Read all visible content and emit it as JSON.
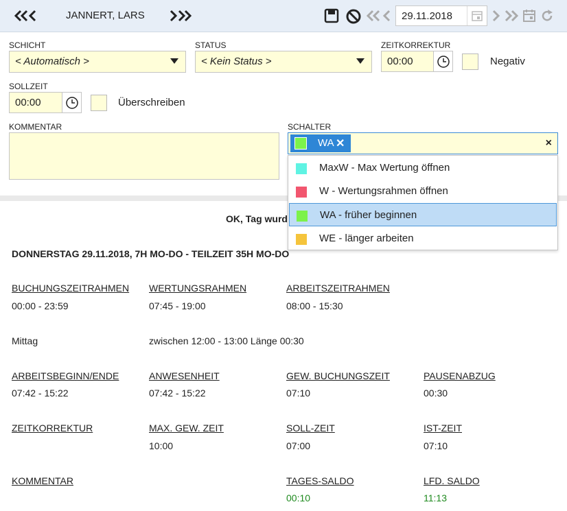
{
  "header": {
    "employee_name": "JANNERT, LARS",
    "date": "29.11.2018",
    "icons": {
      "prev_employee": "double-chevron-left",
      "next_employee": "double-chevron-right",
      "save": "save-icon",
      "cancel": "cancel-icon",
      "first_day": "double-chevron-left",
      "prev_day": "chevron-left",
      "calendar": "calendar-icon",
      "next_day": "chevron-right",
      "last_day": "double-chevron-right",
      "today": "calendar-today-icon",
      "refresh": "refresh-icon"
    }
  },
  "form": {
    "schicht_label": "SCHICHT",
    "schicht_value": "< Automatisch >",
    "status_label": "STATUS",
    "status_value": "< Kein Status >",
    "zeitkorrektur_label": "ZEITKORREKTUR",
    "zeitkorrektur_value": "00:00",
    "negativ_label": "Negativ",
    "sollzeit_label": "SOLLZEIT",
    "sollzeit_value": "00:00",
    "ueberschreiben_label": "Überschreiben",
    "kommentar_label": "KOMMENTAR",
    "kommentar_value": "",
    "schalter_label": "SCHALTER",
    "schalter_selected": {
      "code": "WA",
      "color": "#7cf24b"
    }
  },
  "dropdown": {
    "options": [
      {
        "label": "MaxW - Max Wertung öffnen",
        "color": "#5ff3e3"
      },
      {
        "label": "W - Wertungsrahmen öffnen",
        "color": "#f2566f"
      },
      {
        "label": "WA - früher beginnen",
        "color": "#7cf24b",
        "selected": true
      },
      {
        "label": "WE - länger arbeiten",
        "color": "#f5c43c"
      }
    ]
  },
  "message": "OK, Tag wurde",
  "day": {
    "header": "DONNERSTAG 29.11.2018, 7H MO-DO - TEILZEIT 35H MO-DO",
    "buchungszeitrahmen_label": "BUCHUNGSZEITRAHMEN",
    "buchungszeitrahmen_value": "00:00 - 23:59",
    "wertungsrahmen_label": "WERTUNGSRAHMEN",
    "wertungsrahmen_value": "07:45 - 19:00",
    "arbeitszeitrahmen_label": "ARBEITSZEITRAHMEN",
    "arbeitszeitrahmen_value": "08:00 - 15:30",
    "mittag_label": "Mittag",
    "mittag_value": "zwischen 12:00 - 13:00 Länge 00:30",
    "arbeitsbeginn_label": "ARBEITSBEGINN/ENDE",
    "arbeitsbeginn_value": "07:42 - 15:22",
    "anwesenheit_label": "ANWESENHEIT",
    "anwesenheit_value": "07:42 - 15:22",
    "gew_buchungszeit_label": "GEW. BUCHUNGSZEIT",
    "gew_buchungszeit_value": "07:10",
    "pausenabzug_label": "PAUSENABZUG",
    "pausenabzug_value": "00:30",
    "zeitkorrektur_label": "ZEITKORREKTUR",
    "max_gew_zeit_label": "MAX. GEW. ZEIT",
    "max_gew_zeit_value": "10:00",
    "soll_zeit_label": "SOLL-ZEIT",
    "soll_zeit_value": "07:00",
    "ist_zeit_label": "IST-ZEIT",
    "ist_zeit_value": "07:10",
    "kommentar_label": "KOMMENTAR",
    "tages_saldo_label": "TAGES-SALDO",
    "tages_saldo_value": "00:10",
    "lfd_saldo_label": "LFD. SALDO",
    "lfd_saldo_value": "11:13"
  }
}
